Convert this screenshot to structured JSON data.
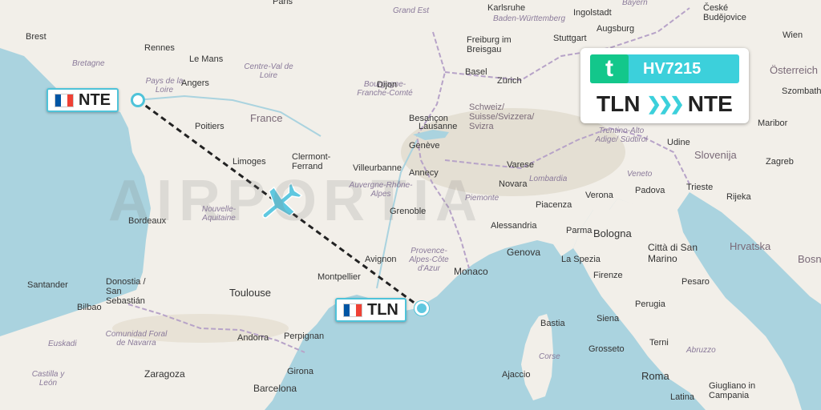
{
  "flight": {
    "number": "HV7215",
    "origin": "TLN",
    "destination": "NTE",
    "airline_color": "#13c78b",
    "accent_color": "#3cd0db",
    "logo_glyph": "t"
  },
  "airports": {
    "origin_tag": {
      "code": "TLN",
      "flag": "france-flag"
    },
    "destination_tag": {
      "code": "NTE",
      "flag": "france-flag"
    }
  },
  "watermark": "AIRPORTIA",
  "map_labels": {
    "paris": "Paris",
    "grand_est": "Grand Est",
    "karlsruhe": "Karlsruhe",
    "baden": "Baden-Württemberg",
    "ingolstadt": "Ingolstadt",
    "bayern": "Bayern",
    "ceske": "České Budějovice",
    "brest": "Brest",
    "rennes": "Rennes",
    "le_mans": "Le Mans",
    "bretagne": "Bretagne",
    "pays_de_la_loire": "Pays de la Loire",
    "angers": "Angers",
    "centre": "Centre-Val de Loire",
    "bourgogne": "Bourgogne-Franche-Comté",
    "dijon": "Dijon",
    "besancon": "Besançon",
    "basel": "Basel",
    "zurich": "Zürich",
    "freiburg": "Freiburg im Breisgau",
    "augsburg": "Augsburg",
    "stuttgart": "Stuttgart",
    "wien": "Wien",
    "osterreich": "Österreich",
    "szombathely": "Szombathe",
    "schweiz": "Schweiz/ Suisse/Svizzera/ Svizra",
    "france": "France",
    "poitiers": "Poitiers",
    "lausanne": "Lausanne",
    "geneve": "Genève",
    "annecy": "Annecy",
    "clermont": "Clermont-Ferrand",
    "limoges": "Limoges",
    "villeurbanne": "Villeurbanne",
    "auvergne": "Auvergne-Rhône-Alpes",
    "grenoble": "Grenoble",
    "bordeaux": "Bordeaux",
    "nouvelle_aquitaine": "Nouvelle-Aquitaine",
    "trentino": "Trentino-Alto Adige/ Südtirol",
    "udine": "Udine",
    "slovenija": "Slovenija",
    "maribor": "Maribor",
    "zagreb": "Zagreb",
    "varese": "Varese",
    "lombardia": "Lombardia",
    "novara": "Novara",
    "verona": "Verona",
    "padova": "Padova",
    "veneto": "Veneto",
    "trieste": "Trieste",
    "rijeka": "Rijeka",
    "piemonte": "Piemonte",
    "piacenza": "Piacenza",
    "alessandria": "Alessandria",
    "parma": "Parma",
    "bologna": "Bologna",
    "citta": "Città di San Marino",
    "hrvatska": "Hrvatska",
    "bosna": "Bosn",
    "provence": "Provence-Alpes-Côte d'Azur",
    "avignon": "Avignon",
    "monaco": "Monaco",
    "genova": "Genova",
    "la_spezia": "La Spezia",
    "firenze": "Firenze",
    "perugia": "Perugia",
    "pesaro": "Pesaro",
    "santander": "Santander",
    "donostia": "Donostia / San Sebastián",
    "bilbao": "Bilbao",
    "euskadi": "Euskadi",
    "toulouse": "Toulouse",
    "montpellier": "Montpellier",
    "andorra": "Andorra",
    "perpignan": "Perpignan",
    "navarra": "Comunidad Foral de Navarra",
    "castilla": "Castilla y León",
    "zaragoza": "Zaragoza",
    "girona": "Girona",
    "barcelona": "Barcelona",
    "siena": "Siena",
    "grosseto": "Grosseto",
    "terni": "Terni",
    "abruzzo": "Abruzzo",
    "roma": "Roma",
    "latina": "Latina",
    "giugliano": "Giugliano in Campania",
    "ajaccio": "Ajaccio",
    "corse": "Corse",
    "bastia": "Bastia"
  }
}
